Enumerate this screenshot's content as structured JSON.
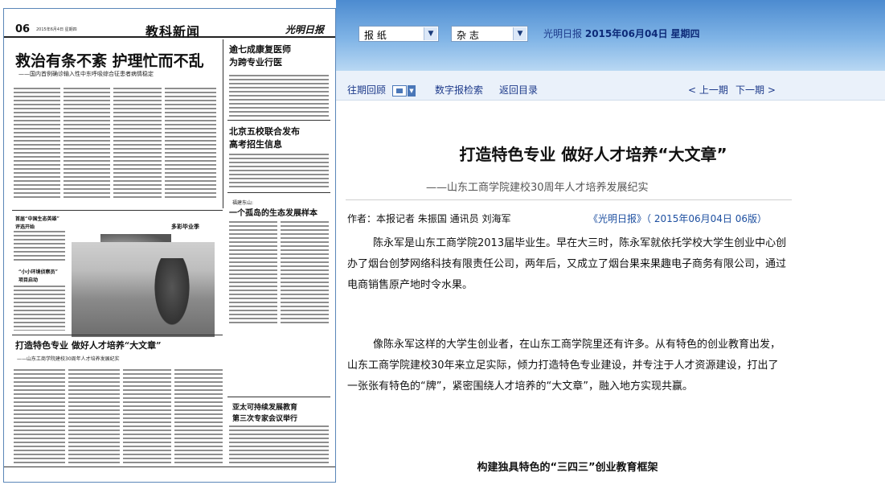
{
  "paper": {
    "page_number": "06",
    "date_line": "2015年6月4日  星期四",
    "section": "教科新闻",
    "logo": "光明日报",
    "headline_main": "救治有条不紊  护理忙而不乱",
    "subheadline_main": "——国内首例确诊输入性中东呼吸综合征患者病情稳定",
    "headline_right1": "逾七成康复医师",
    "headline_right2": "为跨专业行医",
    "headline_mid1": "北京五校联合发布",
    "headline_mid2": "高考招生信息",
    "headline_island_tag": "福建东山:",
    "headline_island": "一个孤岛的生态发展样本",
    "headline_column": "首届“中国生态英雄”",
    "headline_column2": "评选开始",
    "headline_photo": "多彩毕业季",
    "headline_eco": "“小小环境侦察员”",
    "headline_eco2": "项目启动",
    "headline_bottom": "打造特色专业  做好人才培养“大文章”",
    "subheadline_bottom": "——山东工商学院建校30周年人才培养发展纪实",
    "headline_asia1": "亚太可持续发展教育",
    "headline_asia2": "第三次专家会议举行"
  },
  "header": {
    "select1": "报 纸",
    "select2": "杂 志",
    "paper_name": "光明日报",
    "date": "2015年06月04日",
    "weekday": "星期四"
  },
  "toolbar": {
    "back_issues": "往期回顾",
    "digital_search": "数字报检索",
    "return_toc": "返回目录",
    "prev_page": "< 上一期",
    "next_page": "下一期 >"
  },
  "article": {
    "title": "打造特色专业  做好人才培养“大文章”",
    "subtitle": "——山东工商学院建校30周年人才培养发展纪实",
    "byline": "作者：本报记者 朱振国 通讯员 刘海军",
    "source": "《光明日报》（ 2015年06月04日 06版）",
    "para1": "陈永军是山东工商学院2013届毕业生。早在大三时，陈永军就依托学校大学生创业中心创办了烟台创梦网络科技有限责任公司，两年后，又成立了烟台果来果趣电子商务有限公司，通过电商销售原产地时令水果。",
    "para2": "像陈永军这样的大学生创业者，在山东工商学院里还有许多。从有特色的创业教育出发，山东工商学院建校30年来立足实际，倾力打造特色专业建设，并专注于人才资源建设，打出了一张张有特色的“牌”，紧密围绕人才培养的“大文章”，融入地方实现共赢。",
    "section_heading": "构建独具特色的“三四三”创业教育框架"
  }
}
